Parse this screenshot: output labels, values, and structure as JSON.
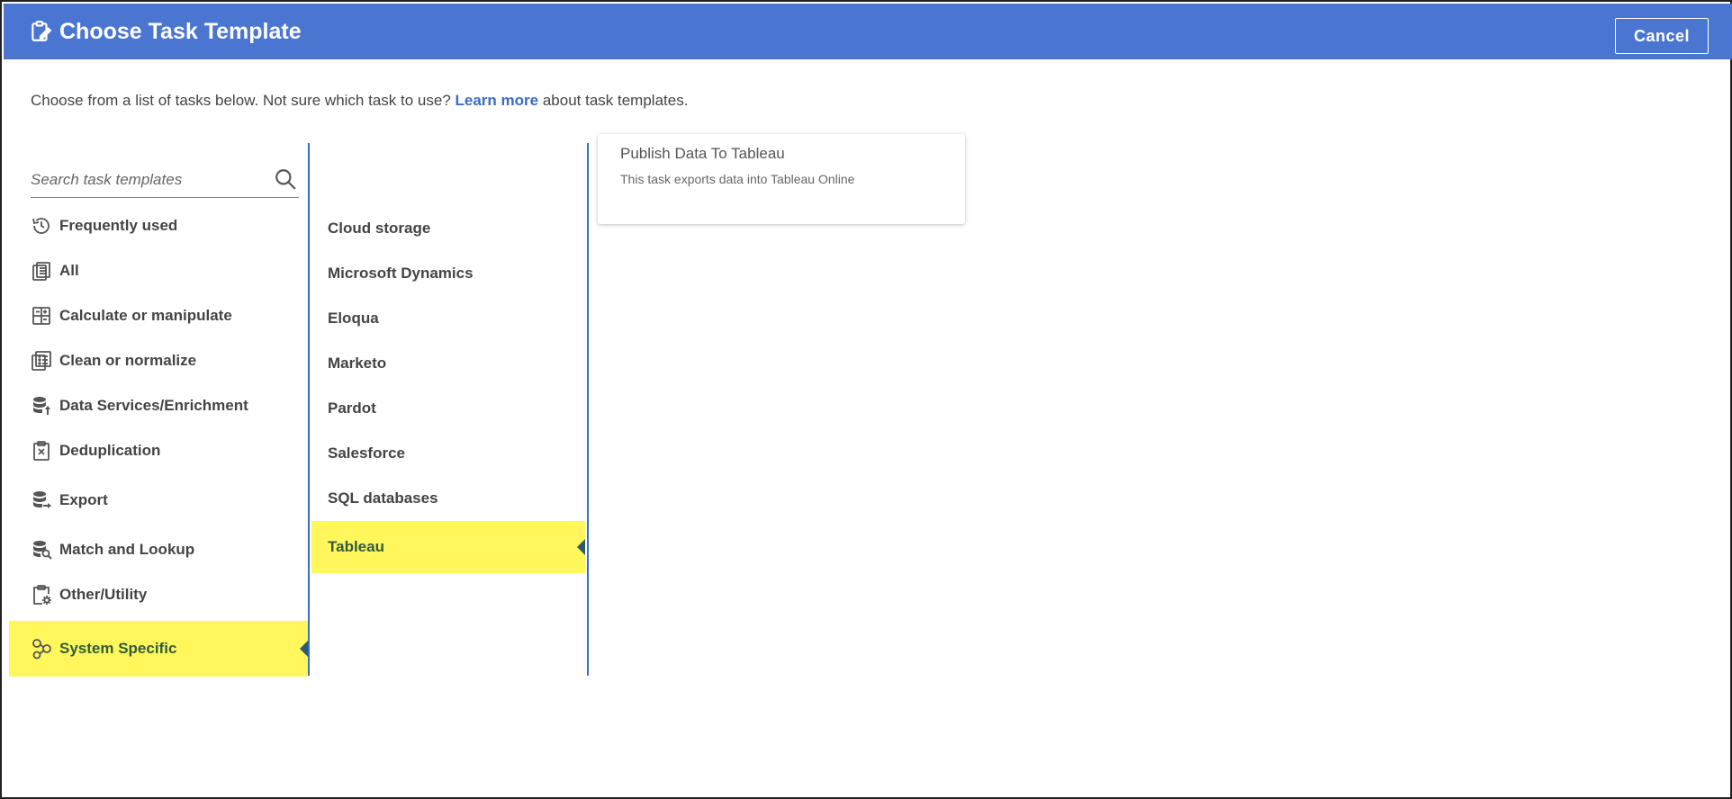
{
  "header": {
    "title": "Choose Task Template",
    "cancel_label": "Cancel",
    "bg_color": "#4a76d1"
  },
  "intro": {
    "before": "Choose from a list of tasks below. Not sure which task to use?",
    "link": "Learn more",
    "after": "about task templates."
  },
  "search": {
    "placeholder": "Search task templates",
    "value": ""
  },
  "categories": [
    {
      "label": "Frequently used",
      "icon": "history-icon"
    },
    {
      "label": "All",
      "icon": "clipboard-list-icon"
    },
    {
      "label": "Calculate or manipulate",
      "icon": "calculator-icon"
    },
    {
      "label": "Clean or normalize",
      "icon": "clean-list-icon"
    },
    {
      "label": "Data Services/Enrichment",
      "icon": "database-upload-icon"
    },
    {
      "label": "Deduplication",
      "icon": "clipboard-x-icon"
    },
    {
      "label": "Export",
      "icon": "database-export-icon"
    },
    {
      "label": "Match and Lookup",
      "icon": "database-search-icon"
    },
    {
      "label": "Other/Utility",
      "icon": "clipboard-gear-icon"
    },
    {
      "label": "System Specific",
      "icon": "nodes-icon",
      "active": true
    }
  ],
  "systems": [
    {
      "label": "Cloud storage"
    },
    {
      "label": "Microsoft Dynamics"
    },
    {
      "label": "Eloqua"
    },
    {
      "label": "Marketo"
    },
    {
      "label": "Pardot"
    },
    {
      "label": "Salesforce"
    },
    {
      "label": "SQL databases"
    },
    {
      "label": "Tableau",
      "active": true
    }
  ],
  "templates": [
    {
      "title": "Publish Data To Tableau",
      "description": "This task exports data into Tableau Online"
    }
  ],
  "colors": {
    "accent": "#3a6bc7",
    "highlight": "#fff75c",
    "highlight_text": "#2f5d3a"
  }
}
